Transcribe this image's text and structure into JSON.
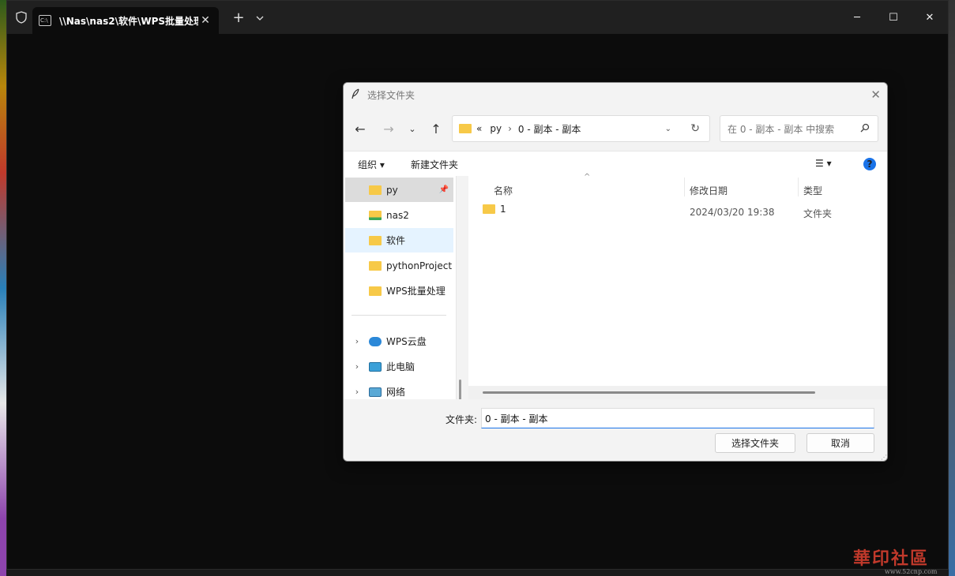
{
  "terminal": {
    "tab_title": "\\\\Nas\\nas2\\软件\\WPS批量处理",
    "tab_icon": "terminal-icon",
    "new_tab": "+",
    "dropdown": "⌄",
    "minimize": "─",
    "maximize": "☐",
    "close": "✕"
  },
  "dialog": {
    "title": "选择文件夹",
    "address": {
      "prefix": "«",
      "segments": [
        "py",
        "0 - 副本 - 副本"
      ]
    },
    "search_placeholder": "在 0 - 副本 - 副本 中搜索",
    "toolbar": {
      "organize": "组织 ▾",
      "new_folder": "新建文件夹",
      "view": "☰ ▾",
      "help": "?"
    },
    "nav": [
      {
        "label": "py",
        "pinned": true
      },
      {
        "label": "nas2"
      },
      {
        "label": "软件",
        "selected": true
      },
      {
        "label": "pythonProject"
      },
      {
        "label": "WPS批量处理"
      },
      {
        "label": "WPS云盘",
        "expandable": true
      },
      {
        "label": "此电脑",
        "expandable": true
      },
      {
        "label": "网络",
        "expandable": true
      }
    ],
    "columns": {
      "name": "名称",
      "date": "修改日期",
      "type": "类型"
    },
    "rows": [
      {
        "name": "1",
        "date": "2024/03/20 19:38",
        "type": "文件夹"
      }
    ],
    "folder_label": "文件夹:",
    "folder_value": "0 - 副本 - 副本",
    "select_button": "选择文件夹",
    "cancel_button": "取消"
  },
  "watermark": {
    "text": "華印社區",
    "url": "www.52cnp.com"
  },
  "colors": {
    "folder": "#f7c948",
    "accent": "#1a73e8",
    "selected": "#e5f3ff"
  }
}
